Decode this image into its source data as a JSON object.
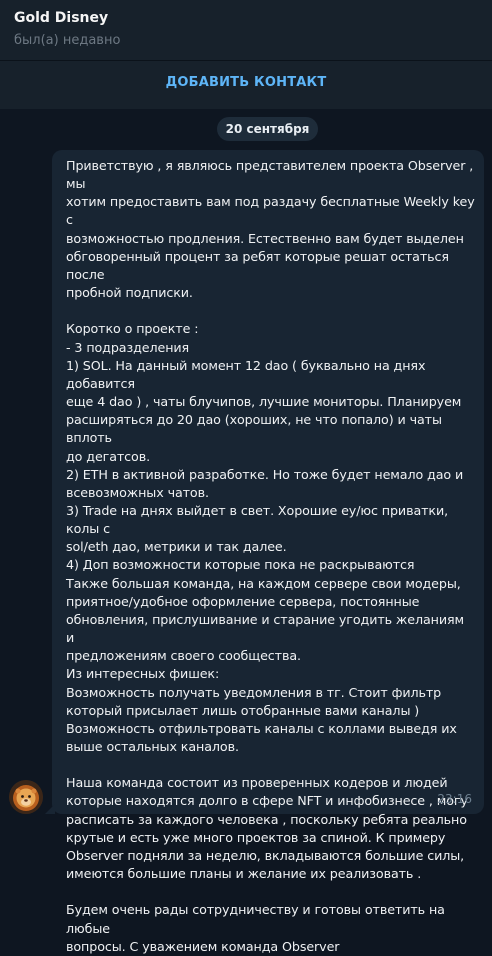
{
  "header": {
    "contact_name": "Gold Disney",
    "status": "был(а) недавно"
  },
  "add_contact": {
    "label": "ДОБАВИТЬ КОНТАКТ"
  },
  "date_separator": "20 сентября",
  "message": {
    "lines": [
      "Приветствую , я являюсь представителем проекта Observer , мы",
      "хотим предоставить вам под раздачу бесплатные Weekly key с",
      "возможностью продления. Естественно вам будет выделен",
      "обговоренный процент за ребят которые решат остаться после",
      "пробной подписки.",
      "",
      "Коротко о проекте :",
      "- 3 подразделения",
      "1) SOL. На данный момент 12 dao ( буквально на днях добавится",
      "еще 4 dao ) , чаты блучипов, лучшие мониторы. Планируем",
      "расширяться до 20 дао (хороших, не что попало) и чаты вплоть",
      "до дегатсов.",
      "2) ETH в активной разработке. Но тоже будет немало дао и",
      "всевозможных чатов.",
      "3) Trade на днях выйдет в свет. Хорошие еу/юс приватки, колы с",
      "sol/eth дао, метрики и так далее.",
      "4) Доп возможности которые пока не раскрываются",
      "Также большая команда, на каждом сервере свои модеры,",
      "приятное/удобное оформление сервера, постоянные",
      "обновления, прислушивание и старание угодить желаниям и",
      "предложениям своего сообщества.",
      "Из интересных фишек:",
      "Возможность получать уведомления в тг. Стоит фильтр",
      "который присылает лишь отобранные вами каналы )",
      "Возможность отфильтровать каналы с коллами выведя их",
      "выше остальных каналов.",
      "",
      "Наша команда состоит из проверенных кодеров и людей",
      "которые находятся долго в сфере NFT и инфобизнесе , могу",
      "расписать за каждого человека , поскольку ребята реально",
      "крутые и есть уже много проектов за спиной. К примеру",
      "Observer подняли за неделю, вкладываются большие силы,",
      "имеются большие планы и желание их реализовать .",
      "",
      "Будем очень рады сотрудничеству и готовы ответить на любые",
      "вопросы. С уважением команда Observer"
    ],
    "time": "23:16"
  },
  "avatar": {
    "icon": "lion-avatar-icon"
  },
  "colors": {
    "background": "#0e1621",
    "header": "#17212b",
    "bubble": "#182533",
    "accent": "#5eb5f7"
  }
}
